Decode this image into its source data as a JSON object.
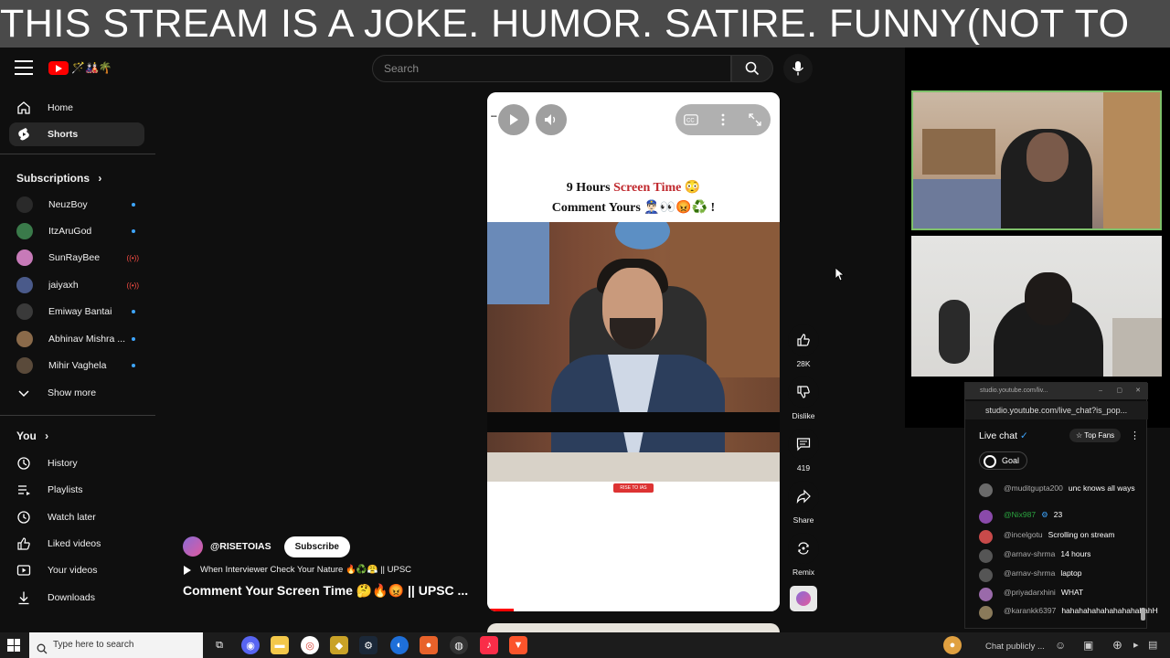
{
  "banner": {
    "text": "THIS STREAM IS A JOKE. HUMOR. SATIRE. FUNNY(NOT TO"
  },
  "header": {
    "search_placeholder": "Search"
  },
  "sidebar": {
    "nav": [
      {
        "label": "Home",
        "icon": "home-icon"
      },
      {
        "label": "Shorts",
        "icon": "shorts-icon",
        "active": true
      }
    ],
    "subscriptions_title": "Subscriptions",
    "subscriptions": [
      {
        "name": "NeuzBoy",
        "status": "dot",
        "color": "#2a2a2a"
      },
      {
        "name": "ItzAruGod",
        "status": "dot",
        "color": "#3a7a4a"
      },
      {
        "name": "SunRayBee",
        "status": "live",
        "color": "#c77ab8"
      },
      {
        "name": "jaiyaxh",
        "status": "live",
        "color": "#4a5a8a"
      },
      {
        "name": "Emiway Bantai",
        "status": "dot",
        "color": "#3a3a3a"
      },
      {
        "name": "Abhinav Mishra ...",
        "status": "dot",
        "color": "#8a6a4a"
      },
      {
        "name": "Mihir Vaghela",
        "status": "dot",
        "color": "#5a4a3a"
      }
    ],
    "show_more": "Show more",
    "you_title": "You",
    "you_items": [
      {
        "label": "History",
        "icon": "history-icon"
      },
      {
        "label": "Playlists",
        "icon": "playlists-icon"
      },
      {
        "label": "Watch later",
        "icon": "watch-later-icon"
      },
      {
        "label": "Liked videos",
        "icon": "thumbs-up-icon"
      },
      {
        "label": "Your videos",
        "icon": "your-videos-icon"
      },
      {
        "label": "Downloads",
        "icon": "download-icon"
      }
    ]
  },
  "short": {
    "caption_line1_pre": "9 Hours ",
    "caption_line1_red": "Screen Time",
    "caption_line1_emoji": " 😳",
    "caption_line2": "Comment Yours 👮🏻‍♂️👀😡♻️ !",
    "tag": "RISE TO IAS",
    "channel": "@RISETOIAS",
    "subscribe": "Subscribe",
    "music": "When Interviewer Check Your Nature 🔥♻️😤 || UPSC",
    "title": "Comment Your Screen Time 🤔🔥😡 || UPSC ...",
    "progress": 0.09
  },
  "actions": {
    "likes": "28K",
    "dislike": "Dislike",
    "comments": "419",
    "share": "Share",
    "remix": "Remix"
  },
  "chat": {
    "window_url_short": "studio.youtube.com/liv...",
    "url": "studio.youtube.com/live_chat?is_pop...",
    "title": "Live chat",
    "top_fans": "Top Fans",
    "goal": "Goal",
    "messages": [
      {
        "author": "@muditgupta200",
        "text": "unc knows all ways",
        "color": "#6a6a6a",
        "mod": false
      },
      {
        "author": "@Nix987",
        "text": "23",
        "color": "#8a4aaa",
        "mod": true
      },
      {
        "author": "@incelgotu",
        "text": "Scrolling on stream",
        "color": "#c84a4a",
        "mod": false
      },
      {
        "author": "@arnav-shrma",
        "text": "14 hours",
        "color": "#555555",
        "mod": false
      },
      {
        "author": "@arnav-shrma",
        "text": "laptop",
        "color": "#555555",
        "mod": false
      },
      {
        "author": "@priyadarxhini",
        "text": "WHAT",
        "color": "#9a6aaa",
        "mod": false
      },
      {
        "author": "@karankk6397",
        "text": "hahahahahahahahahahahH",
        "color": "#8a7a5a",
        "mod": false
      }
    ],
    "input_placeholder": "Chat publicly ..."
  },
  "taskbar": {
    "search_placeholder": "Type here to search"
  }
}
